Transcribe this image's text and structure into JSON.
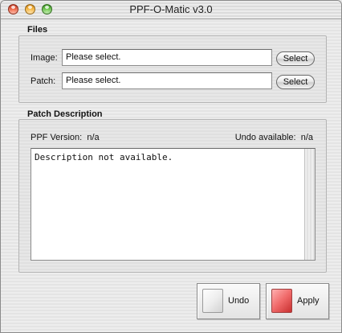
{
  "window": {
    "title": "PPF-O-Matic v3.0",
    "controls": {
      "close_icon": "close-traffic-light",
      "minimize_icon": "minimize-traffic-light",
      "zoom_icon": "zoom-traffic-light",
      "close_color": "#e04a2a",
      "minimize_color": "#f0a41e",
      "zoom_color": "#4eb02e"
    }
  },
  "files": {
    "heading": "Files",
    "image": {
      "label": "Image:",
      "value": "Please select.",
      "button_label": "Select"
    },
    "patch": {
      "label": "Patch:",
      "value": "Please select.",
      "button_label": "Select"
    }
  },
  "patch_description": {
    "heading": "Patch Description",
    "ppf_version_label": "PPF Version:",
    "ppf_version_value": "n/a",
    "undo_available_label": "Undo available:",
    "undo_available_value": "n/a",
    "description": "Description not available."
  },
  "actions": {
    "undo": {
      "label": "Undo",
      "icon": "document-icon"
    },
    "apply": {
      "label": "Apply",
      "icon": "red-document-icon",
      "icon_color": "#f06a6a"
    }
  }
}
